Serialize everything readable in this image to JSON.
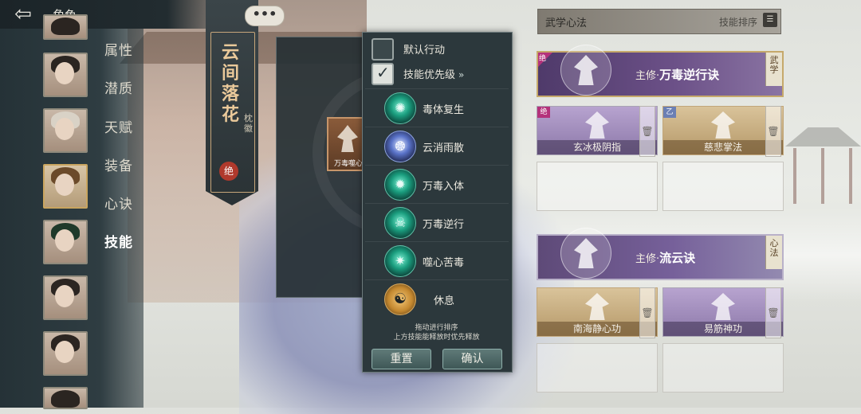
{
  "topbar": {
    "back_icon": "arrow-left-icon",
    "title": "角色"
  },
  "sidebar": {
    "menu": [
      {
        "label": "属性",
        "active": false
      },
      {
        "label": "潜质",
        "active": false
      },
      {
        "label": "天赋",
        "active": false
      },
      {
        "label": "装备",
        "active": false
      },
      {
        "label": "心诀",
        "active": false
      },
      {
        "label": "技能",
        "active": true
      }
    ]
  },
  "banner": {
    "title": "云间落花",
    "subtitle": "枕徽",
    "seal": "绝",
    "more_label": "•••"
  },
  "slot": {
    "card_label": "万毒噬心"
  },
  "popup": {
    "options": [
      {
        "label": "默认行动",
        "checked": false
      },
      {
        "label": "技能优先级",
        "checked": true,
        "arrow": "»"
      }
    ],
    "skills": [
      {
        "name": "毒体复生",
        "icon": "poison-skill-icon",
        "glyph": "✺",
        "style": "green"
      },
      {
        "name": "云消雨散",
        "icon": "cloud-skill-icon",
        "glyph": "❂",
        "style": "blue"
      },
      {
        "name": "万毒入体",
        "icon": "poison-body-skill-icon",
        "glyph": "✹",
        "style": "green"
      },
      {
        "name": "万毒逆行",
        "icon": "skull-skill-icon",
        "glyph": "☠",
        "style": "green"
      },
      {
        "name": "噬心苦毒",
        "icon": "heart-poison-skill-icon",
        "glyph": "✷",
        "style": "green"
      },
      {
        "name": "休息",
        "icon": "meditate-icon",
        "glyph": "☯",
        "style": "rest"
      }
    ],
    "hint_line1": "拖动进行排序",
    "hint_line2": "上方技能能释放时优先释放",
    "reset_label": "重置",
    "confirm_label": "确认"
  },
  "right": {
    "title": "武学心法",
    "sort_label": "技能排序",
    "sort_icon": "sort-icon",
    "martial_main": {
      "prefix": "主修·",
      "name": "万毒逆行诀",
      "tag": "武学",
      "corner": "绝"
    },
    "martial_slots": [
      {
        "label": "玄冰极阴指",
        "tag": "绝",
        "style": "purple"
      },
      {
        "label": "慈悲掌法",
        "tag": "乙",
        "style": "gold"
      }
    ],
    "heart_main": {
      "prefix": "主修·",
      "name": "流云诀",
      "tag": "心法"
    },
    "heart_slots": [
      {
        "label": "南海静心功",
        "style": "gold"
      },
      {
        "label": "易筋神功",
        "style": "purple"
      }
    ]
  },
  "colors": {
    "accent_gold": "#c6a96b",
    "panel_dark": "#2c383c",
    "purple_card": "#6b5087"
  }
}
